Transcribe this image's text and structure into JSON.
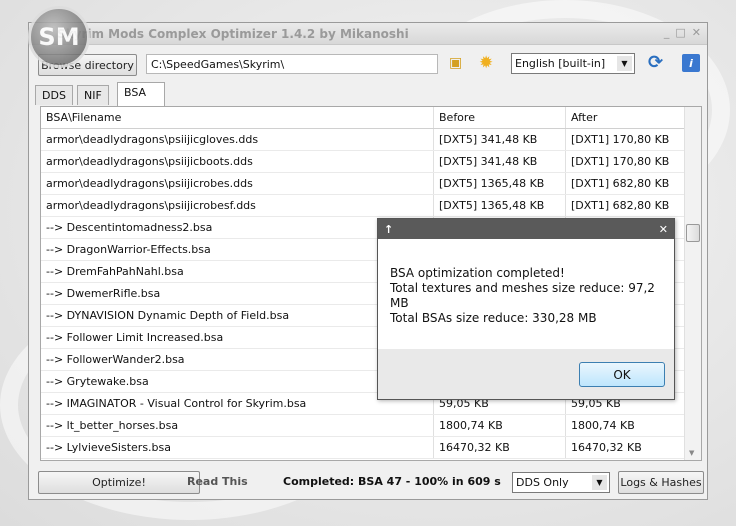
{
  "window": {
    "title": "Skyrim Mods Complex Optimizer 1.4.2 by Mikanoshi",
    "logo_text": "SM"
  },
  "toolbar": {
    "browse_label": "Browse directory",
    "path": "C:\\SpeedGames\\Skyrim\\",
    "language": "English [built-in]"
  },
  "tabs": [
    {
      "label": "DDS"
    },
    {
      "label": "NIF"
    },
    {
      "label": "BSA"
    }
  ],
  "table": {
    "columns": [
      "BSA\\Filename",
      "Before",
      "After"
    ],
    "rows": [
      [
        "armor\\deadlydragons\\psiijicgloves.dds",
        "[DXT5] 341,48 KB",
        "[DXT1] 170,80 KB"
      ],
      [
        "armor\\deadlydragons\\psiijicboots.dds",
        "[DXT5] 341,48 KB",
        "[DXT1] 170,80 KB"
      ],
      [
        "armor\\deadlydragons\\psiijicrobes.dds",
        "[DXT5] 1365,48 KB",
        "[DXT1] 682,80 KB"
      ],
      [
        "armor\\deadlydragons\\psiijicrobesf.dds",
        "[DXT5] 1365,48 KB",
        "[DXT1] 682,80 KB"
      ],
      [
        "--> Descentintomadness2.bsa",
        "",
        ""
      ],
      [
        "--> DragonWarrior-Effects.bsa",
        "",
        ""
      ],
      [
        "--> DremFahPahNahl.bsa",
        "",
        ""
      ],
      [
        "--> DwemerRifle.bsa",
        "",
        ""
      ],
      [
        "--> DYNAVISION Dynamic Depth of Field.bsa",
        "",
        ""
      ],
      [
        "--> Follower Limit Increased.bsa",
        "",
        ""
      ],
      [
        "--> FollowerWander2.bsa",
        "",
        ""
      ],
      [
        "--> Grytewake.bsa",
        "",
        ""
      ],
      [
        "--> IMAGINATOR - Visual Control for Skyrim.bsa",
        "59,05 KB",
        "59,05 KB"
      ],
      [
        "--> lt_better_horses.bsa",
        "1800,74 KB",
        "1800,74 KB"
      ],
      [
        "--> LylvieveSisters.bsa",
        "16470,32 KB",
        "16470,32 KB"
      ]
    ]
  },
  "dialog": {
    "lines": [
      "BSA optimization completed!",
      "Total textures and meshes size reduce: 97,2 MB",
      "Total BSAs size reduce: 330,28 MB"
    ],
    "ok_label": "OK"
  },
  "bottom": {
    "optimize_label": "Optimize!",
    "read_this": "Read This",
    "status": "Completed: BSA 47 - 100% in 609 s",
    "mode": "DDS Only",
    "logs_label": "Logs & Hashes"
  }
}
